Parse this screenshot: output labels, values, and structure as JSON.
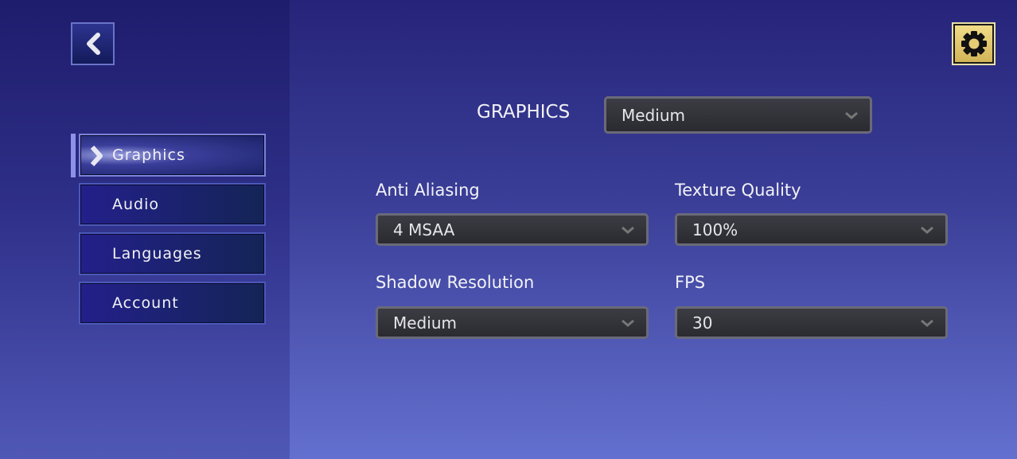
{
  "header": {
    "back_icon": "chevron-left-icon",
    "settings_icon": "gear-icon",
    "settings_color": "#e0c870"
  },
  "sidebar": {
    "items": [
      {
        "label": "Graphics",
        "active": true
      },
      {
        "label": "Audio"
      },
      {
        "label": "Languages"
      },
      {
        "label": "Account"
      }
    ]
  },
  "graphics": {
    "label": "GRAPHICS",
    "preset": "Medium",
    "settings": [
      {
        "label": "Anti Aliasing",
        "value": "4 MSAA"
      },
      {
        "label": "Texture Quality",
        "value": "100%"
      },
      {
        "label": "Shadow Resolution",
        "value": "Medium"
      },
      {
        "label": "FPS",
        "value": "30"
      }
    ]
  }
}
